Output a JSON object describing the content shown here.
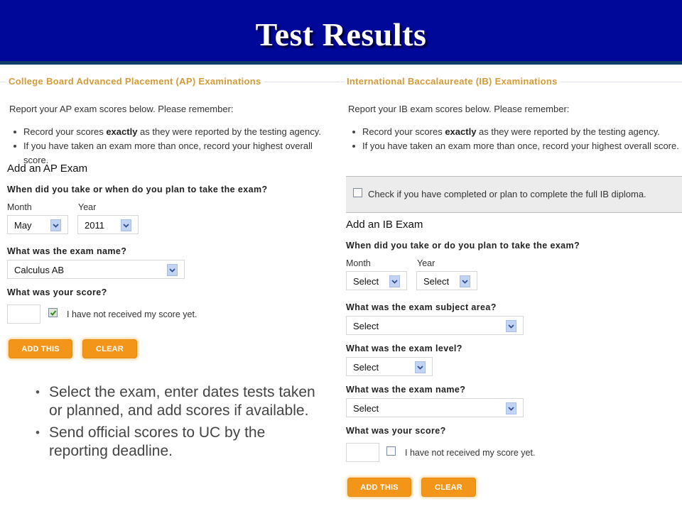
{
  "slide": {
    "title": "Test Results"
  },
  "ap": {
    "legend": "College Board Advanced Placement (AP) Examinations",
    "intro": "Report your AP exam scores below. Please remember:",
    "rules": [
      {
        "pre": "Record your scores ",
        "bold": "exactly",
        "post": " as they were reported by the testing agency."
      },
      {
        "pre": "If you have taken an exam more than once, record your highest overall score.",
        "bold": "",
        "post": ""
      }
    ],
    "heading": "Add an AP Exam",
    "q_when": "When did you take or when do you plan to take the exam?",
    "month_label": "Month",
    "year_label": "Year",
    "month_value": "May",
    "year_value": "2011",
    "q_name": "What was the exam name?",
    "exam_name_value": "Calculus AB",
    "q_score": "What was your score?",
    "score_value": "",
    "not_received_label": "I have not received my score yet.",
    "not_received_checked": true,
    "add_button": "ADD THIS",
    "clear_button": "CLEAR"
  },
  "ib": {
    "legend": "International Baccalaureate (IB) Examinations",
    "intro": "Report your IB exam scores below. Please remember:",
    "rules": [
      {
        "pre": "Record your scores ",
        "bold": "exactly",
        "post": " as they were reported by the testing agency."
      },
      {
        "pre": "If you have taken an exam more than once, record your highest overall score.",
        "bold": "",
        "post": ""
      }
    ],
    "diploma_label": "Check if you have completed or plan to complete the full IB diploma.",
    "diploma_checked": false,
    "heading": "Add an IB Exam",
    "q_when": "When did you take or do you plan to take the exam?",
    "month_label": "Month",
    "year_label": "Year",
    "month_value": "Select",
    "year_value": "Select",
    "q_subject": "What was the exam subject area?",
    "subject_value": "Select",
    "q_level": "What was the exam level?",
    "level_value": "Select",
    "q_name": "What was the exam name?",
    "exam_name_value": "Select",
    "q_score": "What was your score?",
    "score_value": "",
    "not_received_label": "I have not received my score yet.",
    "not_received_checked": false,
    "add_button": "ADD THIS",
    "clear_button": "CLEAR"
  },
  "notes": [
    "Select the exam, enter dates tests taken or planned, and add scores if available.",
    "Send official scores to UC by the reporting deadline."
  ],
  "icons": {
    "dropdown": "chevron-down-icon",
    "check": "checkmark-icon",
    "bullet": "•"
  },
  "colors": {
    "header_bg": "#000899",
    "legend_text": "#d39a36",
    "button_bg": "#f39518"
  }
}
